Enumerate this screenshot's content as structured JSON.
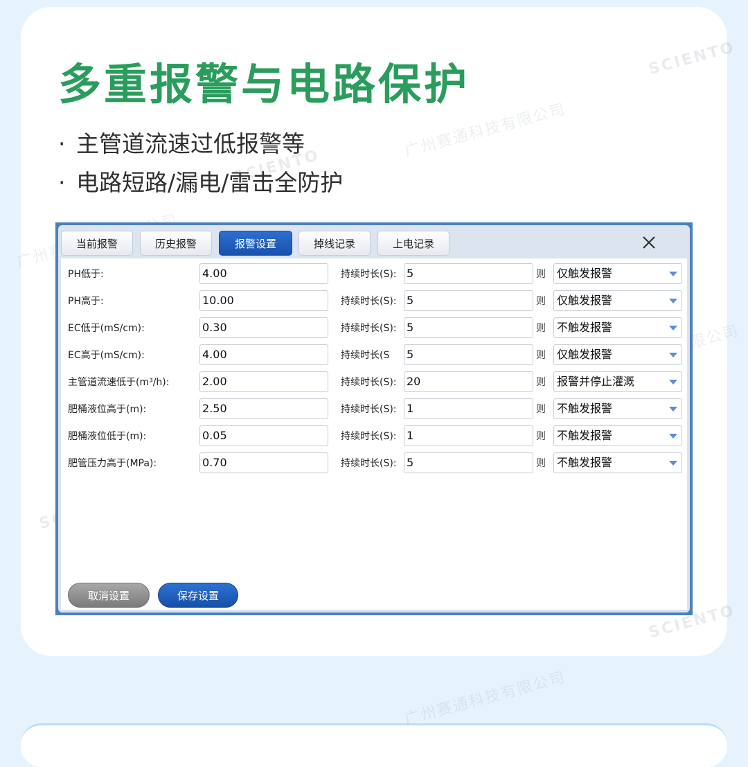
{
  "heading": {
    "title": "多重报警与电路保护",
    "bullets": [
      "主管道流速过低报警等",
      "电路短路/漏电/雷击全防护"
    ],
    "bullet_mark": "·"
  },
  "watermark": {
    "text": "广州赛通科技有限公司",
    "logo_text": "SCIENTO",
    "logo_sub": "赛通科技"
  },
  "window": {
    "tabs": [
      "当前报警",
      "历史报警",
      "报警设置",
      "掉线记录",
      "上电记录"
    ],
    "active_tab": "报警设置",
    "close_glyph": "✕"
  },
  "alarm_rows": [
    {
      "label": "PH低于:",
      "value": "4.00",
      "duration_label": "持续时长(S):",
      "duration": "5",
      "then": "则",
      "action": "仅触发报警"
    },
    {
      "label": "PH高于:",
      "value": "10.00",
      "duration_label": "持续时长(S):",
      "duration": "5",
      "then": "则",
      "action": "仅触发报警"
    },
    {
      "label": "EC低于(mS/cm):",
      "value": "0.30",
      "duration_label": "持续时长(S):",
      "duration": "5",
      "then": "则",
      "action": "不触发报警"
    },
    {
      "label": "EC高于(mS/cm):",
      "value": "4.00",
      "duration_label": "持续时长(S",
      "duration": "5",
      "then": "则",
      "action": "仅触发报警"
    },
    {
      "label": "主管道流速低于(m³/h):",
      "value": "2.00",
      "duration_label": "持续时长(S):",
      "duration": "20",
      "then": "则",
      "action": "报警并停止灌溉"
    },
    {
      "label": "肥桶液位高于(m):",
      "value": "2.50",
      "duration_label": "持续时长(S):",
      "duration": "1",
      "then": "则",
      "action": "不触发报警"
    },
    {
      "label": "肥桶液位低于(m):",
      "value": "0.05",
      "duration_label": "持续时长(S):",
      "duration": "1",
      "then": "则",
      "action": "不触发报警"
    },
    {
      "label": "肥管压力高于(MPa):",
      "value": "0.70",
      "duration_label": "持续时长(S):",
      "duration": "5",
      "then": "则",
      "action": "不触发报警"
    }
  ],
  "buttons": {
    "cancel": "取消设置",
    "save": "保存设置"
  },
  "colors": {
    "title_green": "#2a9d5c",
    "window_blue": "#4c80bc",
    "active_tab": "#1e5fbf",
    "background": "#e6f2fc"
  }
}
